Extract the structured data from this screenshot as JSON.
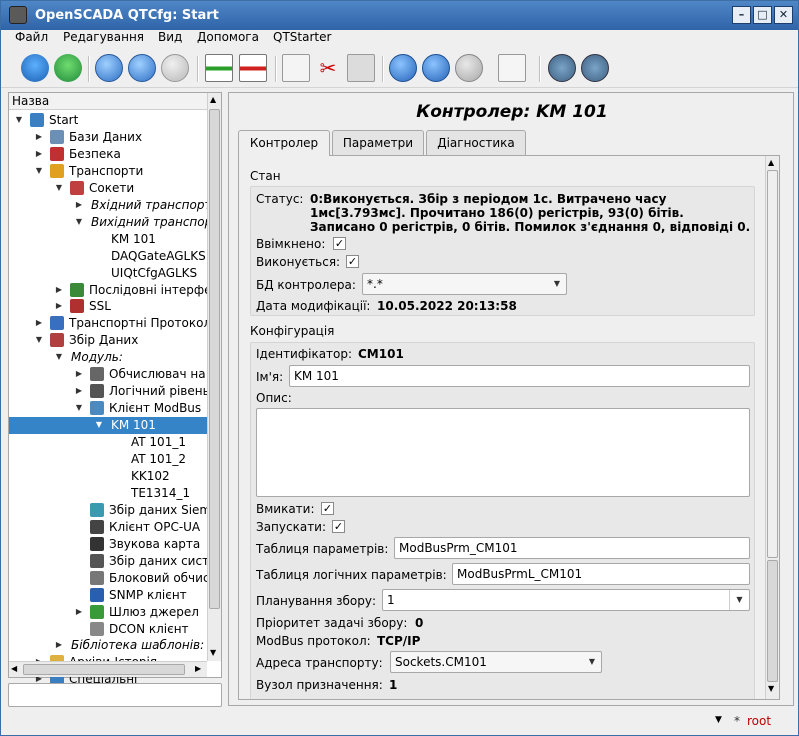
{
  "window": {
    "title": "OpenSCADA QTCfg: Start",
    "min": "–",
    "max": "□",
    "close": "✕"
  },
  "menu": [
    "Файл",
    "Редагування",
    "Вид",
    "Допомога",
    "QTStarter"
  ],
  "toolbar": {
    "icons": [
      "load-db",
      "save-db",
      "up",
      "back",
      "forward",
      "add-item",
      "delete-item",
      "copy",
      "cut",
      "paste",
      "refresh",
      "start",
      "stop",
      "manual",
      "start-station",
      "stop-station"
    ]
  },
  "tree": {
    "header": "Назва",
    "items": [
      {
        "label": "Start",
        "level": 0,
        "arrow": "down",
        "icon": "station"
      },
      {
        "label": "Бази Даних",
        "level": 1,
        "arrow": "right",
        "icon": "db"
      },
      {
        "label": "Безпека",
        "level": 1,
        "arrow": "right",
        "icon": "security"
      },
      {
        "label": "Транспорти",
        "level": 1,
        "arrow": "down",
        "icon": "transport"
      },
      {
        "label": "Сокети",
        "level": 2,
        "arrow": "down",
        "icon": "sockets"
      },
      {
        "label": "Вхідний транспорт",
        "level": 3,
        "arrow": "right",
        "italic": true
      },
      {
        "label": "Вихідний транспорт",
        "level": 3,
        "arrow": "down",
        "italic": true
      },
      {
        "label": "KM 101",
        "level": 4
      },
      {
        "label": "DAQGateAGLKS",
        "level": 4
      },
      {
        "label": "UIQtCfgAGLKS",
        "level": 4
      },
      {
        "label": "Послідовні інтерфейси",
        "level": 2,
        "arrow": "right",
        "icon": "serial"
      },
      {
        "label": "SSL",
        "level": 2,
        "arrow": "right",
        "icon": "ssl"
      },
      {
        "label": "Транспортні Протоколи",
        "level": 1,
        "arrow": "right",
        "icon": "protocols"
      },
      {
        "label": "Збір Даних",
        "level": 1,
        "arrow": "down",
        "icon": "daq"
      },
      {
        "label": "Модуль:",
        "level": 2,
        "arrow": "down",
        "italic": true
      },
      {
        "label": "Обчислювач на",
        "level": 3,
        "arrow": "right",
        "icon": "calc"
      },
      {
        "label": "Логічний рівень",
        "level": 3,
        "arrow": "right",
        "icon": "logic"
      },
      {
        "label": "Клієнт ModBus",
        "level": 3,
        "arrow": "down",
        "icon": "modbus"
      },
      {
        "label": "KM 101",
        "level": 4,
        "arrow": "down",
        "selected": true
      },
      {
        "label": "AT 101_1",
        "level": 5
      },
      {
        "label": "AT 101_2",
        "level": 5
      },
      {
        "label": "KK102",
        "level": 5
      },
      {
        "label": "TE1314_1",
        "level": 5
      },
      {
        "label": "Збір даних Siemens",
        "level": 3,
        "icon": "siemens"
      },
      {
        "label": "Клієнт OPC-UA",
        "level": 3,
        "icon": "opcua"
      },
      {
        "label": "Звукова карта",
        "level": 3,
        "icon": "sound"
      },
      {
        "label": "Збір даних систем",
        "level": 3,
        "icon": "system"
      },
      {
        "label": "Блоковий обчислювач",
        "level": 3,
        "icon": "block"
      },
      {
        "label": "SNMP клієнт",
        "level": 3,
        "icon": "snmp"
      },
      {
        "label": "Шлюз джерел",
        "level": 3,
        "arrow": "right",
        "icon": "gate"
      },
      {
        "label": "DCON клієнт",
        "level": 3,
        "icon": "dcon"
      },
      {
        "label": "Бібліотека шаблонів:",
        "level": 2,
        "arrow": "right",
        "italic": true
      },
      {
        "label": "Архіви-Історія",
        "level": 1,
        "arrow": "right",
        "icon": "archive"
      },
      {
        "label": "Спеціальні",
        "level": 1,
        "arrow": "right",
        "icon": "special"
      }
    ]
  },
  "page": {
    "title": "Контролер: KM 101",
    "tabs": [
      "Контролер",
      "Параметри",
      "Діагностика"
    ],
    "state": {
      "group": "Стан",
      "status_label": "Статус:",
      "status_lines": [
        "0:Виконується. Збір з періодом 1с. Витрачено часу",
        "1мс[3.793мс]. Прочитано 186(0) регістрів, 93(0) бітів.",
        "Записано 0 регістрів, 0 бітів. Помилок з'єднання 0, відповіді 0."
      ],
      "enabled_label": "Ввімкнено:",
      "enabled": "✓",
      "running_label": "Виконується:",
      "running": "✓",
      "db_label": "БД контролера:",
      "db_value": "*.*",
      "modified_label": "Дата модифікації:",
      "modified_value": "10.05.2022 20:13:58"
    },
    "config": {
      "group": "Конфігурація",
      "id_label": "Ідентифікатор:",
      "id_value": "CM101",
      "name_label": "Ім'я:",
      "name_value": "KM 101",
      "descr_label": "Опис:",
      "descr_value": "",
      "enable_label": "Вмикати:",
      "enable": "✓",
      "start_label": "Запускати:",
      "start": "✓",
      "prm_table_label": "Таблиця параметрів:",
      "prm_table_value": "ModBusPrm_CM101",
      "prml_table_label": "Таблиця логічних параметрів:",
      "prml_table_value": "ModBusPrmL_CM101",
      "schedule_label": "Планування збору:",
      "schedule_value": "1",
      "priority_label": "Пріоритет задачі збору:",
      "priority_value": "0",
      "protocol_label": "ModBus протокол:",
      "protocol_value": "TCP/IP",
      "transport_label": "Адреса транспорту:",
      "transport_value": "Sockets.CM101",
      "node_label": "Вузол призначення:",
      "node_value": "1"
    }
  },
  "status_bar": {
    "user": "root"
  }
}
